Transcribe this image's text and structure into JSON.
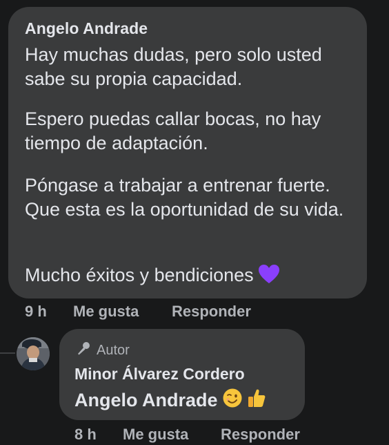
{
  "comment": {
    "author": "Angelo Andrade",
    "paragraphs": [
      "Hay muchas dudas, pero solo usted sabe su propia capacidad.",
      "Espero puedas callar bocas, no hay tiempo de adaptación.",
      "Póngase a trabajar a entrenar fuerte. Que esta es la oportunidad de su vida.",
      "Mucho éxitos y bendiciones"
    ],
    "emoji": "purple-heart",
    "time": "9 h",
    "like_label": "Me gusta",
    "reply_label": "Responder"
  },
  "reply": {
    "badge_label": "Autor",
    "author": "Minor Álvarez Cordero",
    "tag": "Angelo Andrade",
    "emojis": [
      "winking-face",
      "thumbs-up"
    ],
    "time": "8 h",
    "like_label": "Me gusta",
    "reply_label": "Responder"
  },
  "colors": {
    "background": "#18191a",
    "bubble": "#3a3b3c",
    "text": "#e4e6eb",
    "secondary": "#b0b3b8",
    "heart": "#8a3ffc"
  }
}
